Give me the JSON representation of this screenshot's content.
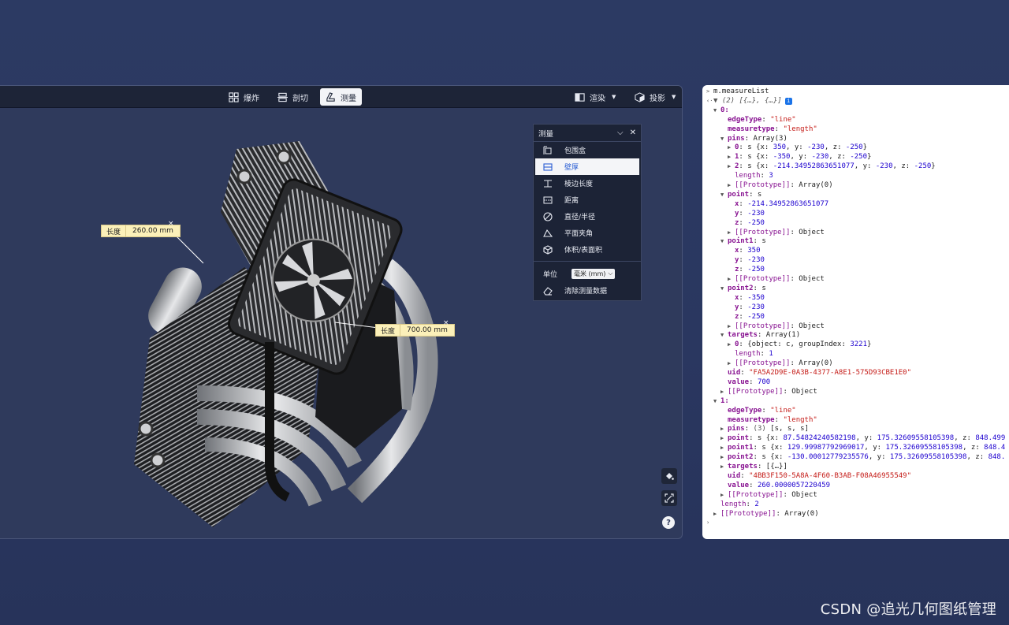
{
  "toolbar": {
    "explode": "爆炸",
    "section": "剖切",
    "measure": "测量",
    "render": "渲染",
    "projection": "投影"
  },
  "measure_labels": [
    {
      "key": "长度",
      "value": "260.00 mm",
      "close": "×"
    },
    {
      "key": "长度",
      "value": "700.00 mm",
      "close": "×"
    }
  ],
  "measure_panel": {
    "title": "测量",
    "items": [
      {
        "label": "包围盒",
        "icon": "bounding-box-icon"
      },
      {
        "label": "壁厚",
        "icon": "wall-thickness-icon",
        "active": true
      },
      {
        "label": "棱边长度",
        "icon": "edge-length-icon"
      },
      {
        "label": "距离",
        "icon": "distance-icon"
      },
      {
        "label": "直径/半径",
        "icon": "diameter-icon"
      },
      {
        "label": "平面夹角",
        "icon": "angle-icon"
      },
      {
        "label": "体积/表面积",
        "icon": "volume-icon"
      }
    ],
    "unit_label": "单位",
    "unit_value": "毫米 (mm)",
    "clear_label": "清除测量数据"
  },
  "help": "?",
  "console": {
    "lines": [
      {
        "indent": 0,
        "tri": ">",
        "parts": [
          [
            "m.measureList",
            "plain"
          ]
        ]
      },
      {
        "indent": 0,
        "tri": "‹·",
        "parts": [
          [
            "▼ (2) [{…}, {…}]",
            "gryi"
          ]
        ],
        "badge": "i"
      },
      {
        "indent": 1,
        "tri": "▼",
        "parts": [
          [
            "0:",
            "pk"
          ]
        ]
      },
      {
        "indent": 2,
        "tri": "",
        "parts": [
          [
            "edgeType",
            "pk"
          ],
          [
            ": ",
            "plain"
          ],
          [
            "\"line\"",
            "str"
          ]
        ]
      },
      {
        "indent": 2,
        "tri": "",
        "parts": [
          [
            "measuretype",
            "pk"
          ],
          [
            ": ",
            "plain"
          ],
          [
            "\"length\"",
            "str"
          ]
        ]
      },
      {
        "indent": 2,
        "tri": "▼",
        "parts": [
          [
            "pins",
            "pk"
          ],
          [
            ": Array(3)",
            "plain"
          ]
        ]
      },
      {
        "indent": 3,
        "tri": "▶",
        "parts": [
          [
            "0",
            "pk"
          ],
          [
            ": s {x: ",
            "plain"
          ],
          [
            "350",
            "num"
          ],
          [
            ", y: ",
            "plain"
          ],
          [
            "-230",
            "num"
          ],
          [
            ", z: ",
            "plain"
          ],
          [
            "-250",
            "num"
          ],
          [
            "}",
            "plain"
          ]
        ]
      },
      {
        "indent": 3,
        "tri": "▶",
        "parts": [
          [
            "1",
            "pk"
          ],
          [
            ": s {x: ",
            "plain"
          ],
          [
            "-350",
            "num"
          ],
          [
            ", y: ",
            "plain"
          ],
          [
            "-230",
            "num"
          ],
          [
            ", z: ",
            "plain"
          ],
          [
            "-250",
            "num"
          ],
          [
            "}",
            "plain"
          ]
        ]
      },
      {
        "indent": 3,
        "tri": "▶",
        "parts": [
          [
            "2",
            "pk"
          ],
          [
            ": s {x: ",
            "plain"
          ],
          [
            "-214.34952863651077",
            "num"
          ],
          [
            ", y: ",
            "plain"
          ],
          [
            "-230",
            "num"
          ],
          [
            ", z: ",
            "plain"
          ],
          [
            "-250",
            "num"
          ],
          [
            "}",
            "plain"
          ]
        ]
      },
      {
        "indent": 3,
        "tri": "",
        "parts": [
          [
            "length",
            "pk2"
          ],
          [
            ": ",
            "plain"
          ],
          [
            "3",
            "num"
          ]
        ]
      },
      {
        "indent": 3,
        "tri": "▶",
        "parts": [
          [
            "[[Prototype]]",
            "pk2"
          ],
          [
            ": Array(0)",
            "plain"
          ]
        ]
      },
      {
        "indent": 2,
        "tri": "▼",
        "parts": [
          [
            "point",
            "pk"
          ],
          [
            ": s",
            "plain"
          ]
        ]
      },
      {
        "indent": 3,
        "tri": "",
        "parts": [
          [
            "x",
            "pk"
          ],
          [
            ": ",
            "plain"
          ],
          [
            "-214.34952863651077",
            "num"
          ]
        ]
      },
      {
        "indent": 3,
        "tri": "",
        "parts": [
          [
            "y",
            "pk"
          ],
          [
            ": ",
            "plain"
          ],
          [
            "-230",
            "num"
          ]
        ]
      },
      {
        "indent": 3,
        "tri": "",
        "parts": [
          [
            "z",
            "pk"
          ],
          [
            ": ",
            "plain"
          ],
          [
            "-250",
            "num"
          ]
        ]
      },
      {
        "indent": 3,
        "tri": "▶",
        "parts": [
          [
            "[[Prototype]]",
            "pk2"
          ],
          [
            ": Object",
            "plain"
          ]
        ]
      },
      {
        "indent": 2,
        "tri": "▼",
        "parts": [
          [
            "point1",
            "pk"
          ],
          [
            ": s",
            "plain"
          ]
        ]
      },
      {
        "indent": 3,
        "tri": "",
        "parts": [
          [
            "x",
            "pk"
          ],
          [
            ": ",
            "plain"
          ],
          [
            "350",
            "num"
          ]
        ]
      },
      {
        "indent": 3,
        "tri": "",
        "parts": [
          [
            "y",
            "pk"
          ],
          [
            ": ",
            "plain"
          ],
          [
            "-230",
            "num"
          ]
        ]
      },
      {
        "indent": 3,
        "tri": "",
        "parts": [
          [
            "z",
            "pk"
          ],
          [
            ": ",
            "plain"
          ],
          [
            "-250",
            "num"
          ]
        ]
      },
      {
        "indent": 3,
        "tri": "▶",
        "parts": [
          [
            "[[Prototype]]",
            "pk2"
          ],
          [
            ": Object",
            "plain"
          ]
        ]
      },
      {
        "indent": 2,
        "tri": "▼",
        "parts": [
          [
            "point2",
            "pk"
          ],
          [
            ": s",
            "plain"
          ]
        ]
      },
      {
        "indent": 3,
        "tri": "",
        "parts": [
          [
            "x",
            "pk"
          ],
          [
            ": ",
            "plain"
          ],
          [
            "-350",
            "num"
          ]
        ]
      },
      {
        "indent": 3,
        "tri": "",
        "parts": [
          [
            "y",
            "pk"
          ],
          [
            ": ",
            "plain"
          ],
          [
            "-230",
            "num"
          ]
        ]
      },
      {
        "indent": 3,
        "tri": "",
        "parts": [
          [
            "z",
            "pk"
          ],
          [
            ": ",
            "plain"
          ],
          [
            "-250",
            "num"
          ]
        ]
      },
      {
        "indent": 3,
        "tri": "▶",
        "parts": [
          [
            "[[Prototype]]",
            "pk2"
          ],
          [
            ": Object",
            "plain"
          ]
        ]
      },
      {
        "indent": 2,
        "tri": "▼",
        "parts": [
          [
            "targets",
            "pk"
          ],
          [
            ": Array(1)",
            "plain"
          ]
        ]
      },
      {
        "indent": 3,
        "tri": "▶",
        "parts": [
          [
            "0",
            "pk"
          ],
          [
            ": {object: c, groupIndex: ",
            "plain"
          ],
          [
            "3221",
            "num"
          ],
          [
            "}",
            "plain"
          ]
        ]
      },
      {
        "indent": 3,
        "tri": "",
        "parts": [
          [
            "length",
            "pk2"
          ],
          [
            ": ",
            "plain"
          ],
          [
            "1",
            "num"
          ]
        ]
      },
      {
        "indent": 3,
        "tri": "▶",
        "parts": [
          [
            "[[Prototype]]",
            "pk2"
          ],
          [
            ": Array(0)",
            "plain"
          ]
        ]
      },
      {
        "indent": 2,
        "tri": "",
        "parts": [
          [
            "uid",
            "pk"
          ],
          [
            ": ",
            "plain"
          ],
          [
            "\"FA5A2D9E-0A3B-4377-A8E1-575D93CBE1E0\"",
            "str"
          ]
        ]
      },
      {
        "indent": 2,
        "tri": "",
        "parts": [
          [
            "value",
            "pk"
          ],
          [
            ": ",
            "plain"
          ],
          [
            "700",
            "num"
          ]
        ]
      },
      {
        "indent": 2,
        "tri": "▶",
        "parts": [
          [
            "[[Prototype]]",
            "pk2"
          ],
          [
            ": Object",
            "plain"
          ]
        ]
      },
      {
        "indent": 1,
        "tri": "▼",
        "parts": [
          [
            "1:",
            "pk"
          ]
        ]
      },
      {
        "indent": 2,
        "tri": "",
        "parts": [
          [
            "edgeType",
            "pk"
          ],
          [
            ": ",
            "plain"
          ],
          [
            "\"line\"",
            "str"
          ]
        ]
      },
      {
        "indent": 2,
        "tri": "",
        "parts": [
          [
            "measuretype",
            "pk"
          ],
          [
            ": ",
            "plain"
          ],
          [
            "\"length\"",
            "str"
          ]
        ]
      },
      {
        "indent": 2,
        "tri": "▶",
        "parts": [
          [
            "pins",
            "pk"
          ],
          [
            ": ",
            "plain"
          ],
          [
            "(3)",
            "gry"
          ],
          [
            " [s, s, s]",
            "plain"
          ]
        ]
      },
      {
        "indent": 2,
        "tri": "▶",
        "parts": [
          [
            "point",
            "pk"
          ],
          [
            ": s {x: ",
            "plain"
          ],
          [
            "87.54824240582198",
            "num"
          ],
          [
            ", y: ",
            "plain"
          ],
          [
            "175.32609558105398",
            "num"
          ],
          [
            ", z: ",
            "plain"
          ],
          [
            "848.499",
            "num"
          ]
        ]
      },
      {
        "indent": 2,
        "tri": "▶",
        "parts": [
          [
            "point1",
            "pk"
          ],
          [
            ": s {x: ",
            "plain"
          ],
          [
            "129.99987792969017",
            "num"
          ],
          [
            ", y: ",
            "plain"
          ],
          [
            "175.32609558105398",
            "num"
          ],
          [
            ", z: ",
            "plain"
          ],
          [
            "848.4",
            "num"
          ]
        ]
      },
      {
        "indent": 2,
        "tri": "▶",
        "parts": [
          [
            "point2",
            "pk"
          ],
          [
            ": s {x: ",
            "plain"
          ],
          [
            "-130.00012779235576",
            "num"
          ],
          [
            ", y: ",
            "plain"
          ],
          [
            "175.32609558105398",
            "num"
          ],
          [
            ", z: ",
            "plain"
          ],
          [
            "848.",
            "num"
          ]
        ]
      },
      {
        "indent": 2,
        "tri": "▶",
        "parts": [
          [
            "targets",
            "pk"
          ],
          [
            ": [{…}]",
            "plain"
          ]
        ]
      },
      {
        "indent": 2,
        "tri": "",
        "parts": [
          [
            "uid",
            "pk"
          ],
          [
            ": ",
            "plain"
          ],
          [
            "\"4BB3F150-5A8A-4F60-B3AB-F08A46955549\"",
            "str"
          ]
        ]
      },
      {
        "indent": 2,
        "tri": "",
        "parts": [
          [
            "value",
            "pk"
          ],
          [
            ": ",
            "plain"
          ],
          [
            "260.0000057220459",
            "num"
          ]
        ]
      },
      {
        "indent": 2,
        "tri": "▶",
        "parts": [
          [
            "[[Prototype]]",
            "pk2"
          ],
          [
            ": Object",
            "plain"
          ]
        ]
      },
      {
        "indent": 1,
        "tri": "",
        "parts": [
          [
            "length",
            "pk2"
          ],
          [
            ": ",
            "plain"
          ],
          [
            "2",
            "num"
          ]
        ]
      },
      {
        "indent": 1,
        "tri": "▶",
        "parts": [
          [
            "[[Prototype]]",
            "pk2"
          ],
          [
            ": Array(0)",
            "plain"
          ]
        ]
      },
      {
        "indent": 0,
        "tri": "›",
        "parts": [
          [
            "",
            "plain"
          ]
        ],
        "prompt": true
      }
    ]
  },
  "watermark": "CSDN @追光几何图纸管理"
}
